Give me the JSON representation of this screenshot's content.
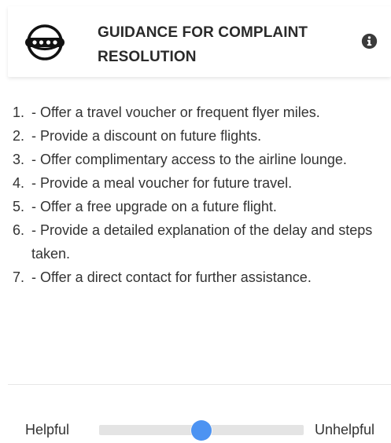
{
  "header": {
    "logo_icon": "headset-support-icon",
    "title_line1": "GUIDANCE FOR COMPLAINT",
    "title_line2": "RESOLUTION",
    "info_icon": "info-icon"
  },
  "suggestions": [
    {
      "num": "1.",
      "text": "- Offer a travel voucher or frequent flyer miles."
    },
    {
      "num": "2.",
      "text": "- Provide a discount on future flights."
    },
    {
      "num": "3.",
      "text": "- Offer complimentary access to the airline lounge."
    },
    {
      "num": "4.",
      "text": "- Provide a meal voucher for future travel."
    },
    {
      "num": "5.",
      "text": "- Offer a free upgrade on a future flight."
    },
    {
      "num": "6.",
      "text": "- Provide a detailed explanation of the delay and steps taken."
    },
    {
      "num": "7.",
      "text": "- Offer a direct contact for further assistance."
    }
  ],
  "rating": {
    "left_label": "Helpful",
    "right_label": "Unhelpful",
    "value": 0.5
  },
  "colors": {
    "accent": "#4c93f2",
    "track": "#e4e4e4"
  }
}
